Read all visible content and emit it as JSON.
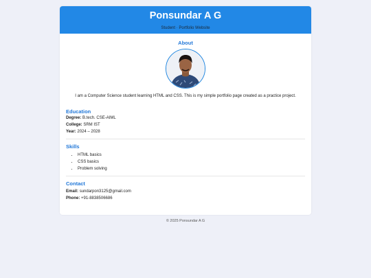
{
  "header": {
    "title": "Ponsundar A G",
    "subtitle": "Student · Portfolio Website"
  },
  "about": {
    "title": "About",
    "bio": "I am a Computer Science student learning HTML and CSS. This is my simple portfolio page created as a practice project."
  },
  "education": {
    "title": "Education",
    "degree_label": "Degree:",
    "degree": "B.tech. CSE-AIML",
    "college_label": "College:",
    "college": "SRM IST",
    "year_label": "Year:",
    "year": "2024 – 2028"
  },
  "skills": {
    "title": "Skills",
    "items": [
      "HTML basics",
      "CSS basics",
      "Problem solving"
    ]
  },
  "contact": {
    "title": "Contact",
    "email_label": "Email:",
    "email": "sundarpon3125@gmail.com",
    "phone_label": "Phone:",
    "phone": "+91-8838506686"
  },
  "footer": {
    "text": "© 2025 Ponsundar A G"
  },
  "colors": {
    "accent": "#2288e6",
    "heading": "#2278d8",
    "background": "#eef0f8"
  }
}
